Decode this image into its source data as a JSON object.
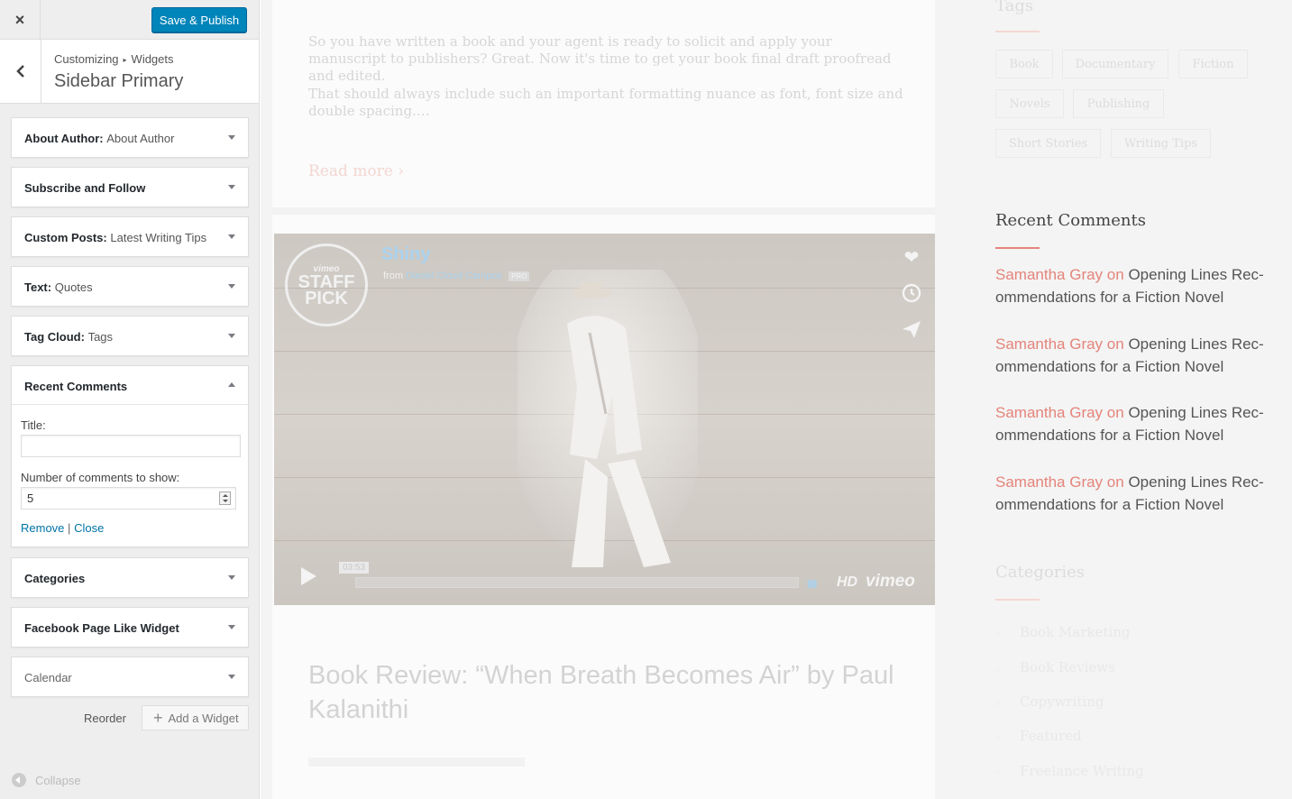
{
  "topbar": {
    "close_glyph": "×",
    "save_label": "Save & Publish"
  },
  "section": {
    "breadcrumb_root": "Customizing",
    "breadcrumb_sep": "▸",
    "breadcrumb_child": "Widgets",
    "title": "Sidebar Primary"
  },
  "widgets": [
    {
      "name": "About Author",
      "sub": "About Author"
    },
    {
      "name": "Subscribe and Follow",
      "sub": ""
    },
    {
      "name": "Custom Posts",
      "sub": "Latest Writing Tips"
    },
    {
      "name": "Text",
      "sub": "Quotes"
    },
    {
      "name": "Tag Cloud",
      "sub": "Tags"
    },
    {
      "name": "Recent Comments",
      "sub": ""
    },
    {
      "name": "Categories",
      "sub": ""
    },
    {
      "name": "Facebook Page Like Widget",
      "sub": ""
    },
    {
      "name": "Calendar",
      "sub": ""
    }
  ],
  "widget_sep": ":",
  "recent_form": {
    "title_label": "Title:",
    "title_value": "",
    "count_label": "Number of comments to show:",
    "count_value": "5",
    "remove_label": "Remove",
    "link_sep": "|",
    "close_label": "Close"
  },
  "footer": {
    "reorder_label": "Reorder",
    "add_widget_label": "Add a Widget",
    "collapse_label": "Collapse"
  },
  "preview": {
    "excerpt_p1": "So you have written a book and your agent is ready to solicit and apply your manuscript to publishers? Great. Now it's time to get your book final draft proofread and edited.",
    "excerpt_p2": "That should always include such an important formatting nuance as font, font size and double spacing.…",
    "read_more": "Read more  ›",
    "video": {
      "badge_top": "vimeo",
      "badge_line1": "STAFF",
      "badge_line2": "PICK",
      "title": "Shiny",
      "from": "from",
      "author": "Daniel Cloud Campos",
      "pro": "PRO",
      "time": "03:53",
      "bars": "IIII",
      "hd": "HD",
      "brand": "vimeo"
    },
    "post2_title": "Book Review: “When Breath Becomes Air” by Paul Kalanithi"
  },
  "blog_sidebar": {
    "tags_heading": "Tags",
    "tags": [
      "Book",
      "Documentary",
      "Fiction",
      "Novels",
      "Publishing",
      "Short Stories",
      "Writing Tips"
    ],
    "recent_heading": "Recent Comments",
    "comments": [
      {
        "author": "Samantha Gray",
        "on": "on",
        "post": "Opening Lines Rec-ommendations for a Fiction Novel"
      },
      {
        "author": "Samantha Gray",
        "on": "on",
        "post": "Opening Lines Rec-ommendations for a Fiction Novel"
      },
      {
        "author": "Samantha Gray",
        "on": "on",
        "post": "Opening Lines Rec-ommendations for a Fiction Novel"
      },
      {
        "author": "Samantha Gray",
        "on": "on",
        "post": "Opening Lines Rec-ommendations for a Fiction Novel"
      }
    ],
    "categories_heading": "Categories",
    "categories": [
      "Book Marketing",
      "Book Reviews",
      "Copywriting",
      "Featured",
      "Freelance Writing"
    ]
  },
  "colors": {
    "accent": "#0085ba",
    "link": "#0073aa",
    "comment_author": "#e4847b"
  }
}
